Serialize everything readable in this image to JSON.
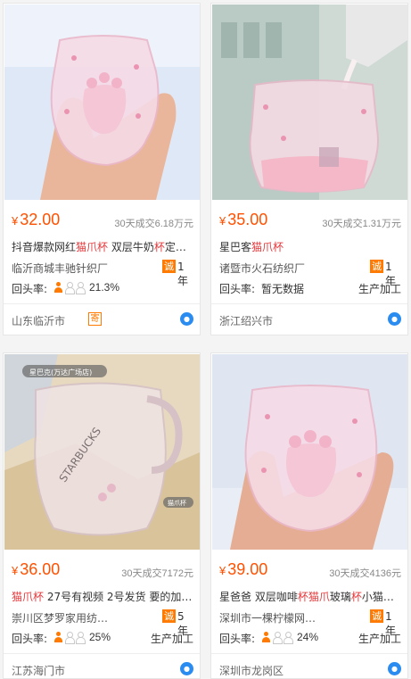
{
  "products": [
    {
      "currency": "¥",
      "price": "32.00",
      "sold": "30天成交6.18万元",
      "title_parts": [
        {
          "text": "抖音爆款网红",
          "hl": false
        },
        {
          "text": "猫爪杯",
          "hl": true
        },
        {
          "text": " 双层牛奶",
          "hl": false
        },
        {
          "text": "杯",
          "hl": true
        },
        {
          "text": "定…",
          "hl": false
        }
      ],
      "shop": "临沂商城丰驰针织厂",
      "cheng": "诚",
      "years": "1年",
      "rate_label": "回头率:",
      "rate_people": [
        true,
        false,
        false
      ],
      "rate_value": "21.3%",
      "service": "",
      "location": "山东临沂市",
      "location_badge": "寄",
      "ww_icon": "wangwang-chat-icon",
      "image_icon": "cat-paw-cup-photo"
    },
    {
      "currency": "¥",
      "price": "35.00",
      "sold": "30天成交1.31万元",
      "title_parts": [
        {
          "text": "星巴客",
          "hl": false
        },
        {
          "text": "猫爪杯",
          "hl": true
        }
      ],
      "shop": "诸暨市火石纺织厂",
      "cheng": "诚",
      "years": "1年",
      "rate_label": "回头率:",
      "rate_people": [],
      "rate_value": "暂无数据",
      "service": "生产加工",
      "location": "浙江绍兴市",
      "location_badge": "",
      "ww_icon": "wangwang-chat-icon",
      "image_icon": "pouring-milk-cup-photo"
    },
    {
      "currency": "¥",
      "price": "36.00",
      "sold": "30天成交7172元",
      "title_parts": [
        {
          "text": "猫爪杯",
          "hl": true
        },
        {
          "text": " 27号有视频 2号发货 要的加…",
          "hl": false
        }
      ],
      "shop": "崇川区梦罗家用纺…",
      "cheng": "诚",
      "years": "5年",
      "rate_label": "回头率:",
      "rate_people": [
        true,
        false,
        false
      ],
      "rate_value": "25%",
      "service": "生产加工",
      "location": "江苏海门市",
      "location_badge": "",
      "ww_icon": "wangwang-chat-icon",
      "image_icon": "starbucks-cup-photo",
      "image_tag": "猫爪杯",
      "image_store": "星巴克(万达广场店)",
      "image_brand": "STARBUCKS"
    },
    {
      "currency": "¥",
      "price": "39.00",
      "sold": "30天成交4136元",
      "title_parts": [
        {
          "text": "星爸爸 双层咖啡",
          "hl": false
        },
        {
          "text": "杯猫爪",
          "hl": true
        },
        {
          "text": "玻璃",
          "hl": false
        },
        {
          "text": "杯",
          "hl": true
        },
        {
          "text": "小猫…",
          "hl": false
        }
      ],
      "shop": "深圳市一棵柠檬网…",
      "cheng": "诚",
      "years": "1年",
      "rate_label": "回头率:",
      "rate_people": [
        true,
        false,
        false
      ],
      "rate_value": "24%",
      "service": "生产加工",
      "location": "深圳市龙岗区",
      "location_badge": "",
      "ww_icon": "wangwang-chat-icon",
      "image_icon": "cat-paw-cup-photo"
    }
  ],
  "colors": {
    "price": "#ff5000",
    "highlight": "#e4393c",
    "cheng": "#ff7a00",
    "ww": "#2a8cf0"
  }
}
